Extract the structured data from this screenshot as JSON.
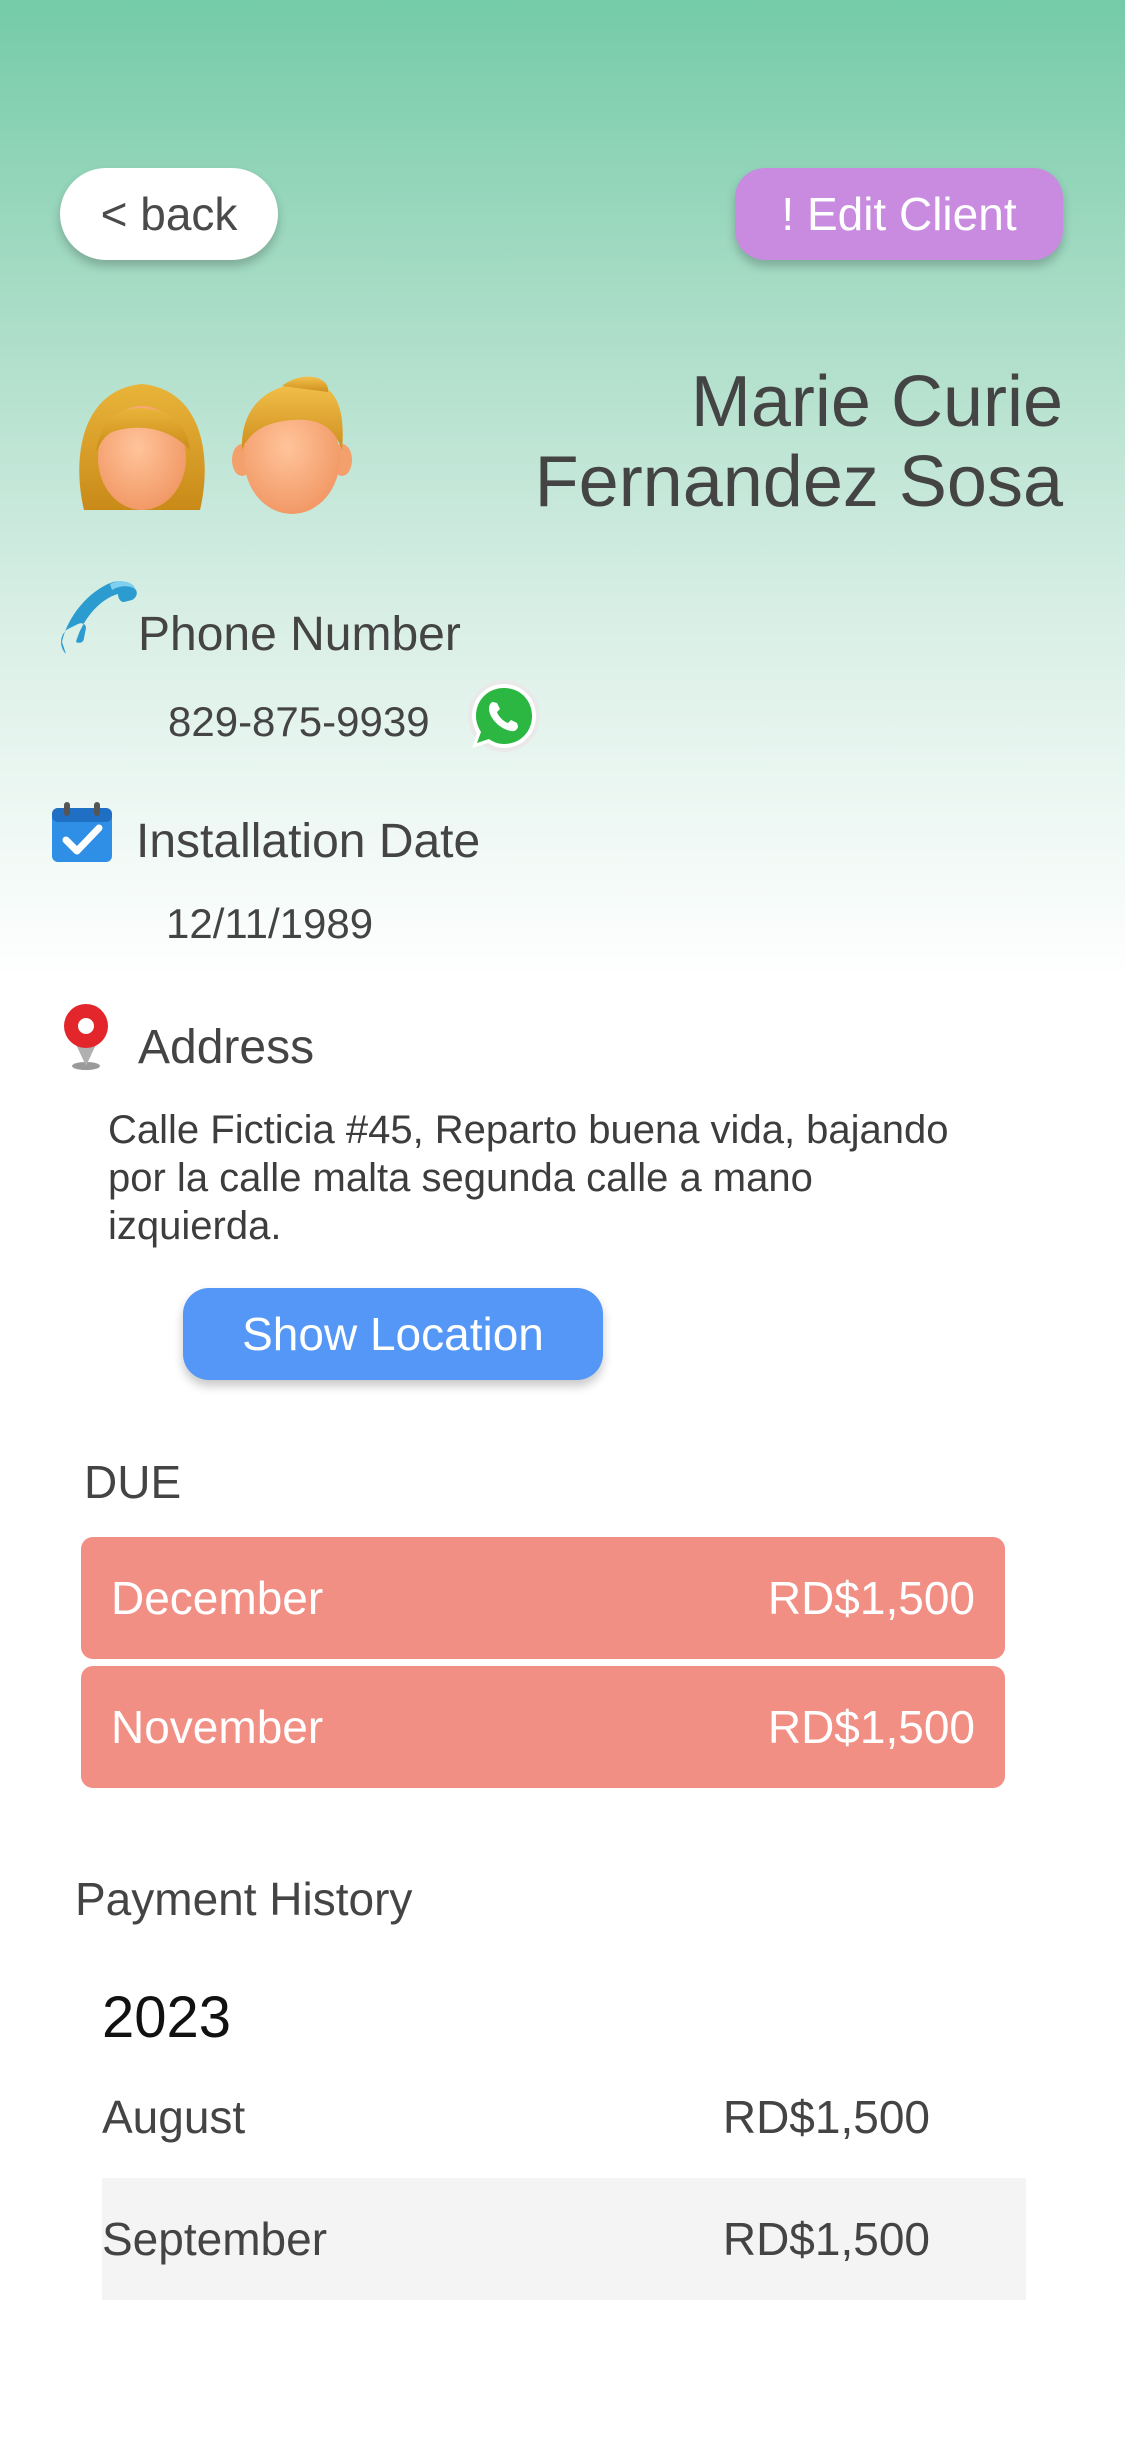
{
  "header": {
    "back_label": "< back",
    "edit_label": "! Edit Client"
  },
  "client": {
    "name_line1": "Marie Curie",
    "name_line2": "Fernandez Sosa"
  },
  "phone": {
    "label": "Phone Number",
    "value": "829-875-9939"
  },
  "installation": {
    "label": "Installation Date",
    "value": "12/11/1989"
  },
  "address": {
    "label": "Address",
    "text": "Calle Ficticia #45, Reparto buena vida, bajando por la calle malta segunda calle a mano izquierda."
  },
  "location_button": "Show Location",
  "due": {
    "heading": "DUE",
    "items": [
      {
        "month": "December",
        "amount": "RD$1,500"
      },
      {
        "month": "November",
        "amount": "RD$1,500"
      }
    ]
  },
  "history": {
    "heading": "Payment History",
    "year": "2023",
    "items": [
      {
        "month": "August",
        "amount": "RD$1,500"
      },
      {
        "month": "September",
        "amount": "RD$1,500"
      }
    ]
  },
  "colors": {
    "gradient_top": "#74cba8",
    "edit_button": "#c88be0",
    "location_button": "#5497f6",
    "due_row": "#f28f84",
    "history_alt_row": "#f4f4f4"
  },
  "icons": [
    "phone-icon",
    "whatsapp-icon",
    "calendar-check-icon",
    "map-pin-icon",
    "woman-avatar-icon",
    "man-avatar-icon"
  ]
}
